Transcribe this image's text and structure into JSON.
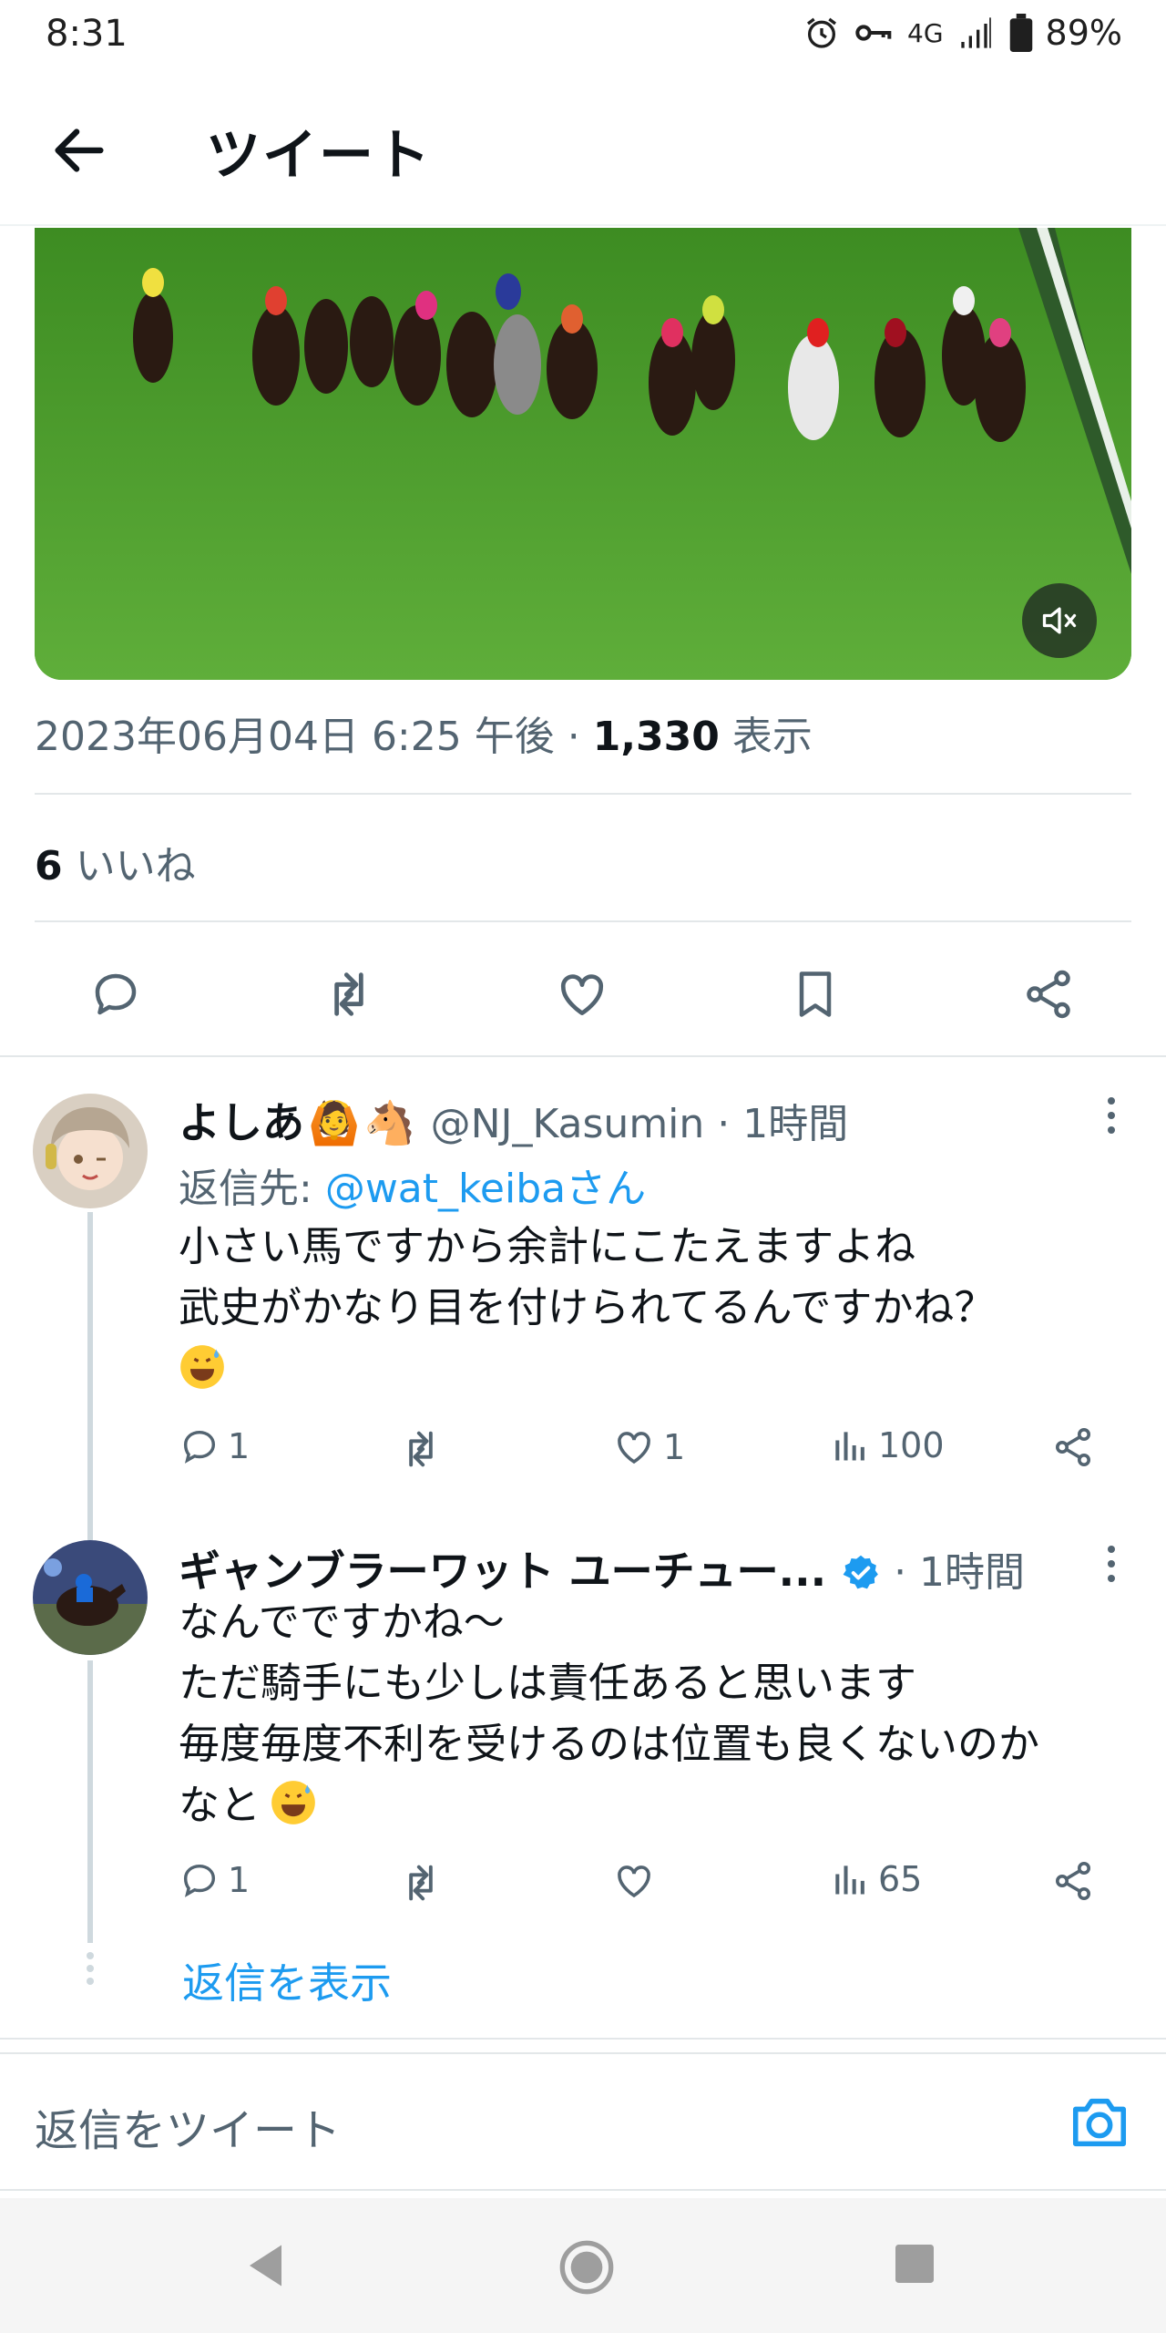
{
  "status": {
    "time": "8:31",
    "network": "4G",
    "battery": "89%"
  },
  "header": {
    "title": "ツイート"
  },
  "tweet": {
    "timestamp": "2023年06月04日 6:25 午後 · ",
    "views_count": "1,330",
    "views_label": " 表示",
    "likes_count": "6",
    "likes_label": " いいね"
  },
  "replies": [
    {
      "name": "よしあ",
      "handle": "@NJ_Kasumin · 1時間",
      "reply_prefix": "返信先: ",
      "reply_to": "@wat_keibaさん",
      "body": "小さい馬ですから余計にこたえますよね\n武史がかなり目を付けられてるんですかね？",
      "replies": "1",
      "likes": "1",
      "views": "100"
    },
    {
      "name": "ギャンブラーワット ユーチュー...",
      "handle": " · 1時間",
      "body": "なんでですかね〜\nただ騎手にも少しは責任あると思います\n毎度毎度不利を受けるのは位置も良くないのか\nなと",
      "replies": "1",
      "likes": "",
      "views": "65"
    }
  ],
  "show_replies": "返信を表示",
  "compose": {
    "placeholder": "返信をツイート"
  },
  "icons": [
    "back-arrow-icon",
    "mute-icon",
    "reply-icon",
    "retweet-icon",
    "like-icon",
    "bookmark-icon",
    "share-icon",
    "views-icon",
    "camera-icon",
    "verified-icon",
    "more-icon"
  ],
  "colors": {
    "accent": "#1d9bf0",
    "muted": "#536471",
    "text": "#0f1419"
  }
}
